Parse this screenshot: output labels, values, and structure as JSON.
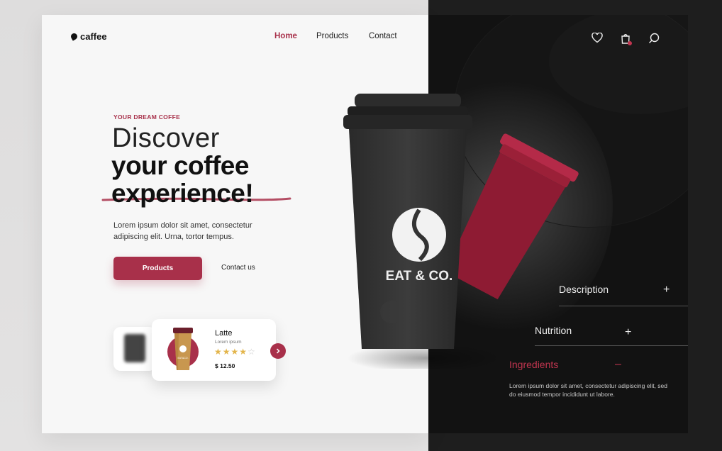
{
  "brand": {
    "name": "caffee"
  },
  "nav": {
    "items": [
      "Home",
      "Products",
      "Contact"
    ],
    "active": "Home"
  },
  "hero": {
    "eyebrow": "YOUR DREAM COFFE",
    "title_light": "Discover",
    "title_bold_1": "your coffee",
    "title_bold_2": "experience!",
    "description": "Lorem ipsum dolor sit amet, consectetur adipiscing elit. Urna, tortor tempus.",
    "primary_button": "Products",
    "secondary_button": "Contact us"
  },
  "product_card": {
    "name": "Latte",
    "subtitle": "Lorem ipsum",
    "rating": 4,
    "rating_max": 5,
    "price": "$ 12.50"
  },
  "cup": {
    "brand_text": "EAT & CO."
  },
  "header_icons": [
    "heart-icon",
    "bag-icon",
    "search-icon"
  ],
  "accordion": [
    {
      "title": "Description",
      "toggle": "+",
      "expanded": false
    },
    {
      "title": "Nutrition",
      "toggle": "+",
      "expanded": false
    },
    {
      "title": "Ingredients",
      "toggle": "–",
      "expanded": true,
      "body": "Lorem ipsum dolor sit amet, consectetur adipiscing elit, sed do eiusmod tempor incididunt ut labore."
    }
  ],
  "colors": {
    "accent": "#a8304a",
    "dark": "#121212",
    "light": "#f7f7f7"
  }
}
